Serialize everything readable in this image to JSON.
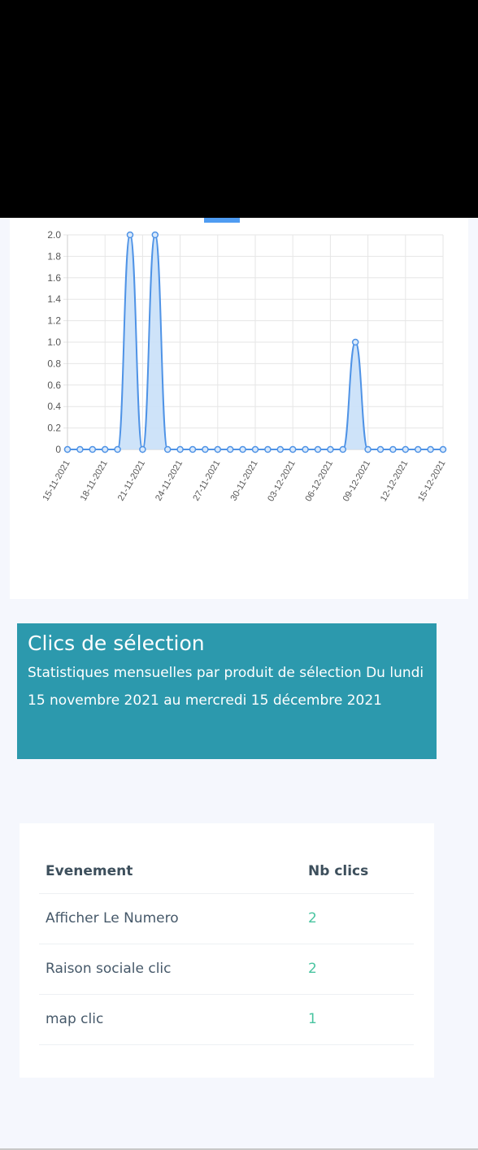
{
  "chart_data": {
    "type": "area",
    "x_tick_labels": [
      "15-11-2021",
      "18-11-2021",
      "21-11-2021",
      "24-11-2021",
      "27-11-2021",
      "30-11-2021",
      "03-12-2021",
      "06-12-2021",
      "09-12-2021",
      "12-12-2021",
      "15-12-2021"
    ],
    "y_tick_labels": [
      "0",
      "0.2",
      "0.4",
      "0.6",
      "0.8",
      "1.0",
      "1.2",
      "1.4",
      "1.6",
      "1.8",
      "2.0"
    ],
    "ylim": [
      0,
      2
    ],
    "x": [
      "15-11-2021",
      "16-11-2021",
      "17-11-2021",
      "18-11-2021",
      "19-11-2021",
      "20-11-2021",
      "21-11-2021",
      "22-11-2021",
      "23-11-2021",
      "24-11-2021",
      "25-11-2021",
      "26-11-2021",
      "27-11-2021",
      "28-11-2021",
      "29-11-2021",
      "30-11-2021",
      "01-12-2021",
      "02-12-2021",
      "03-12-2021",
      "04-12-2021",
      "05-12-2021",
      "06-12-2021",
      "07-12-2021",
      "08-12-2021",
      "09-12-2021",
      "10-12-2021",
      "11-12-2021",
      "12-12-2021",
      "13-12-2021",
      "14-12-2021",
      "15-12-2021"
    ],
    "values": [
      0,
      0,
      0,
      0,
      0,
      2,
      0,
      2,
      0,
      0,
      0,
      0,
      0,
      0,
      0,
      0,
      0,
      0,
      0,
      0,
      0,
      0,
      0,
      1,
      0,
      0,
      0,
      0,
      0,
      0,
      0
    ],
    "colors": {
      "line": "#4f93e6",
      "fill": "#c9e0f8",
      "grid": "#e6e6e6"
    }
  },
  "banner": {
    "title": "Clics de sélection",
    "subtitle": "Statistiques mensuelles par produit de sélection Du lundi 15 novembre 2021 au mercredi 15 décembre 2021"
  },
  "table": {
    "headers": [
      "Evenement",
      "Nb clics"
    ],
    "rows": [
      [
        "Afficher Le Numero",
        "2"
      ],
      [
        "Raison sociale clic",
        "2"
      ],
      [
        "map clic",
        "1"
      ]
    ]
  }
}
